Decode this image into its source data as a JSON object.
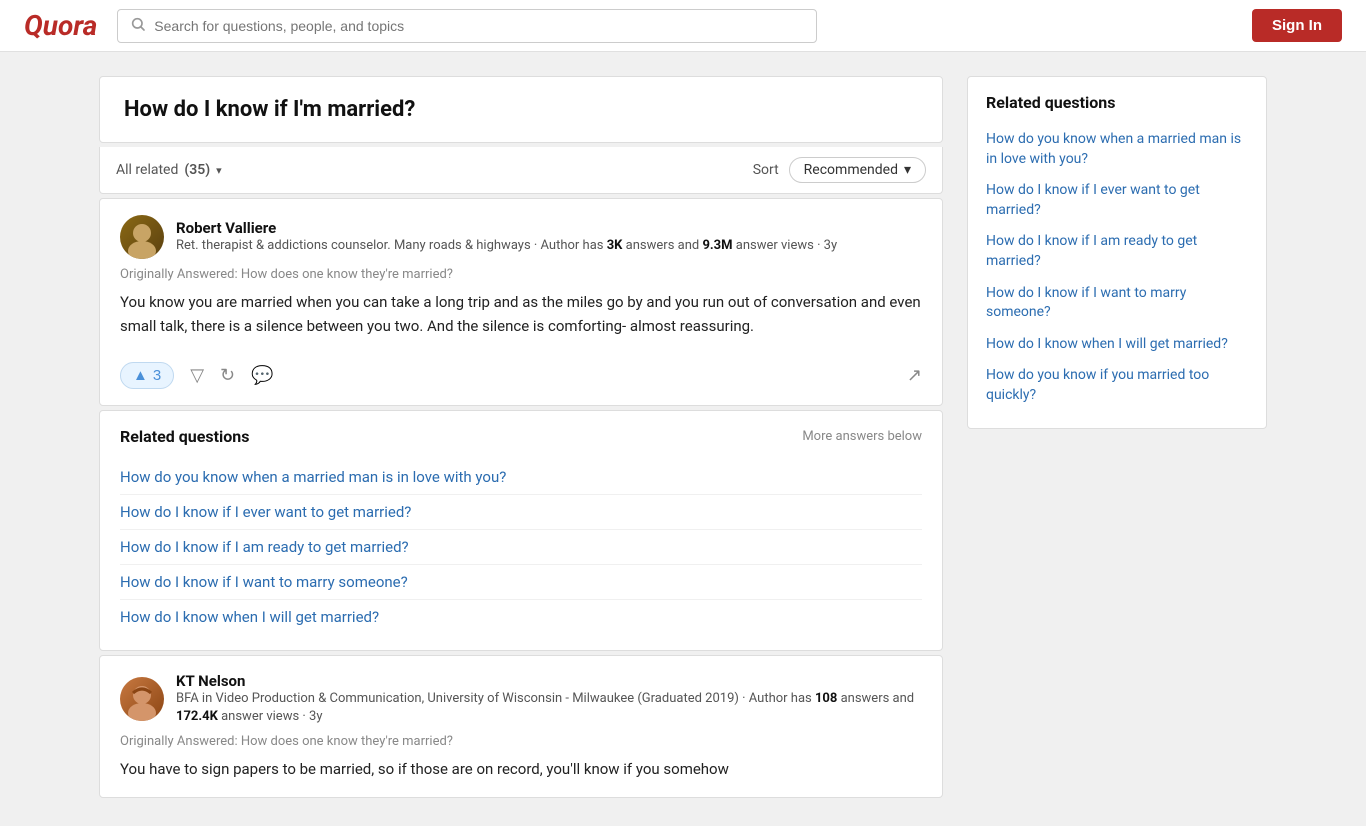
{
  "header": {
    "logo": "Quora",
    "search_placeholder": "Search for questions, people, and topics",
    "sign_in_label": "Sign In"
  },
  "question": {
    "title": "How do I know if I'm married?"
  },
  "filter_bar": {
    "all_related_label": "All related",
    "count": "(35)",
    "sort_label": "Sort",
    "sort_value": "Recommended"
  },
  "answers": [
    {
      "id": "robert",
      "author_name": "Robert Valliere",
      "author_bio": "Ret. therapist & addictions counselor. Many roads & highways · Author has ",
      "answers_count": "3K",
      "bio_mid": " answers and ",
      "views_count": "9.3M",
      "bio_end": " answer views · 3y",
      "originally_answered": "Originally Answered: How does one know they're married?",
      "answer_text": "You know you are married when you can take a long trip and as the miles go by and you run out of conversation and even small talk, there is a silence between you two. And the silence is comforting- almost reassuring.",
      "upvotes": "3"
    },
    {
      "id": "kt",
      "author_name": "KT Nelson",
      "author_bio": "BFA in Video Production & Communication, University of Wisconsin - Milwaukee (Graduated 2019) · Author has ",
      "answers_count": "108",
      "bio_mid": " answers and ",
      "views_count": "172.4K",
      "bio_end": " answer views · 3y",
      "originally_answered": "Originally Answered: How does one know they're married?",
      "answer_text": "You have to sign papers to be married, so if those are on record, you'll know if you somehow"
    }
  ],
  "related_main": {
    "title": "Related questions",
    "more_answers": "More answers below",
    "links": [
      "How do you know when a married man is in love with you?",
      "How do I know if I ever want to get married?",
      "How do I know if I am ready to get married?",
      "How do I know if I want to marry someone?",
      "How do I know when I will get married?"
    ]
  },
  "sidebar": {
    "title": "Related questions",
    "links": [
      "How do you know when a married man is in love with you?",
      "How do I know if I ever want to get married?",
      "How do I know if I am ready to get married?",
      "How do I know if I want to marry someone?",
      "How do I know when I will get married?",
      "How do you know if you married too quickly?"
    ]
  }
}
